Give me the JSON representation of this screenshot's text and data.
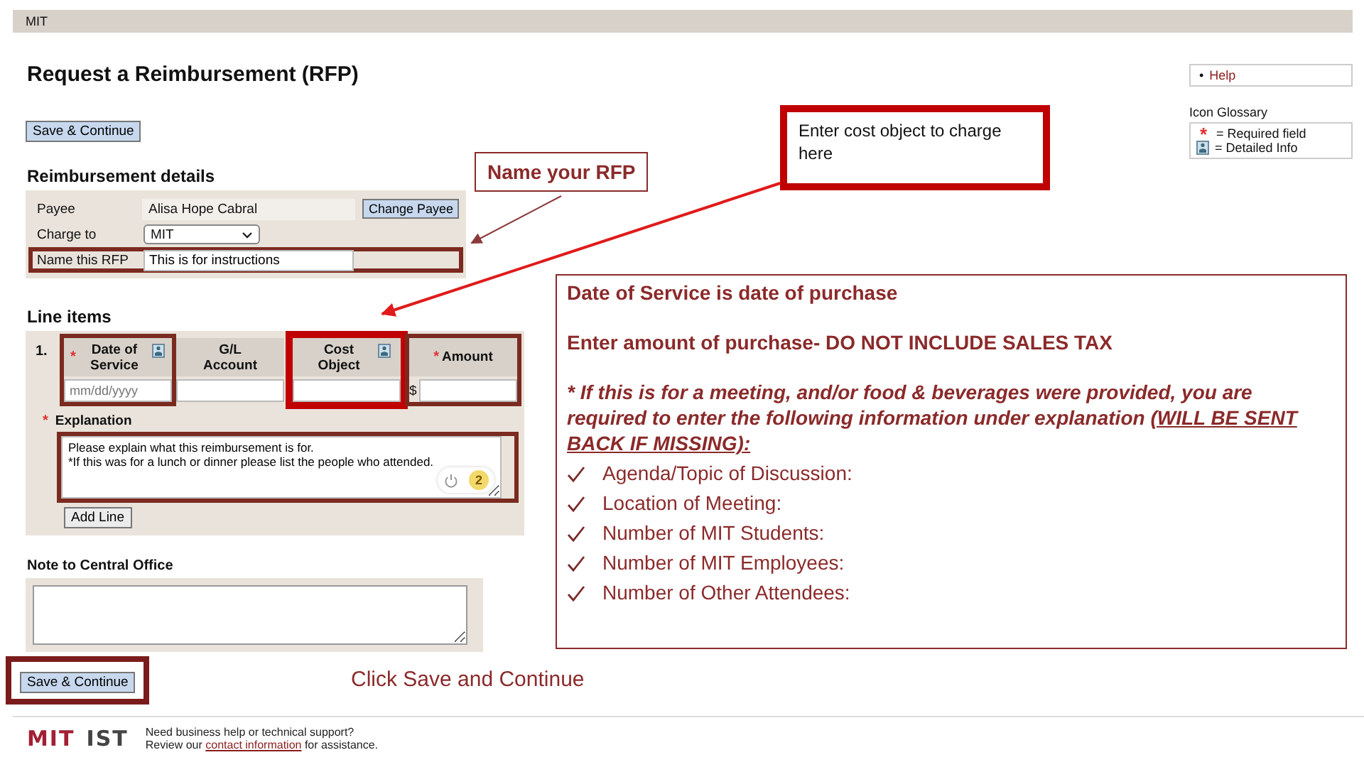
{
  "top_bar": {
    "title": "MIT"
  },
  "page_title": "Request a Reimbursement (RFP)",
  "save_top": {
    "label": "Save & Continue",
    "highlighted": false
  },
  "sidebar": {
    "help_bullet": "•",
    "help_link": "Help",
    "glossary_title": "Icon Glossary",
    "glossary": [
      {
        "kind": "required",
        "symbol": "*",
        "label": "= Required field"
      },
      {
        "kind": "info",
        "label": "= Detailed Info"
      }
    ]
  },
  "details": {
    "heading": "Reimbursement details",
    "rows": [
      {
        "kind": "text",
        "label": "Payee",
        "value": "Alisa Hope Cabral",
        "button": "Change Payee",
        "highlighted": false
      },
      {
        "kind": "select",
        "label": "Charge to",
        "value": "MIT",
        "highlighted": false
      },
      {
        "kind": "input",
        "label": "Name this RFP",
        "value": "This is for instructions",
        "highlighted": true
      }
    ]
  },
  "line_items": {
    "heading": "Line items",
    "number": "1.",
    "columns": [
      {
        "label": "Date of Service",
        "required": true,
        "info": true,
        "placeholder": "mm/dd/yyyy",
        "highlighted": true,
        "color": "#7b2a20"
      },
      {
        "label": "G/L Account",
        "required": false,
        "info": false,
        "highlighted": false
      },
      {
        "label": "Cost Object",
        "required": false,
        "info": true,
        "highlighted": true,
        "color": "#c00000"
      },
      {
        "label": "Amount",
        "required": true,
        "info": false,
        "prefix": "$",
        "highlighted": true,
        "color": "#7b2a20"
      }
    ],
    "explanation": {
      "label": "Explanation",
      "required": true,
      "value": "Please explain what this reimbursement is for.\n*If this was for a lunch or dinner please list the people who attended.",
      "badge": "2",
      "highlighted": true
    },
    "add_button": "Add Line"
  },
  "note": {
    "label": "Note to Central Office"
  },
  "save_bottom": {
    "label": "Save & Continue",
    "highlighted": true
  },
  "footer": {
    "logo_left": "MIT",
    "logo_right": "IST",
    "line1": "Need business help or technical support?",
    "line2_before": "Review our ",
    "link": "contact information",
    "line2_after": " for assistance."
  },
  "callouts": [
    {
      "kind": "outlined",
      "text": "Name your RFP"
    },
    {
      "kind": "strong",
      "text": "Enter cost object to charge here"
    },
    {
      "kind": "plain",
      "text": "Click Save and Continue"
    }
  ],
  "instructions": {
    "lines": [
      {
        "kind": "bold",
        "text": "Date of Service is date of purchase"
      },
      {
        "kind": "bold",
        "text": "Enter amount of purchase- DO NOT INCLUDE SALES TAX"
      }
    ],
    "warning": "* If this is for a meeting, and/or food & beverages were provided, you are required to enter the following information under explanation ",
    "warning_underlined": "(WILL BE SENT BACK IF MISSING):",
    "checklist": [
      "Agenda/Topic of Discussion:",
      "Location of Meeting:",
      "Number of MIT Students:",
      "Number of MIT Employees:",
      "Number of Other Attendees:"
    ]
  }
}
